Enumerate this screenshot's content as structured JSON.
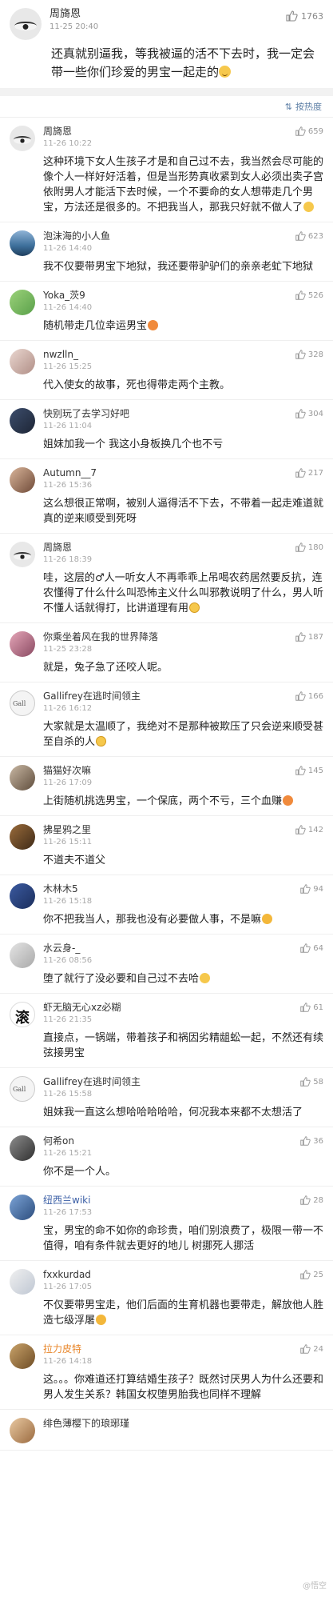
{
  "top_post": {
    "username": "周旖恩",
    "time": "11-25 20:40",
    "likes": "1763",
    "text": "还真就别逼我，等我被逼的活不下去时，我一定会带一些你们珍爱的男宝一起走的"
  },
  "sort": {
    "label": "按热度",
    "icon": "sort-icon"
  },
  "comments": [
    {
      "username": "周旖恩",
      "time": "11-26 10:22",
      "likes": "659",
      "text": "这种环境下女人生孩子才是和自己过不去，我当然会尽可能的像个人一样好好活着，但是当形势真收紧到女人必须出卖子宫依附男人才能活下去时候，一个不要命的女人想带走几个男宝，方法还是很多的。不把我当人，那我只好就不做人了"
    },
    {
      "username": "泡沫海的小人鱼",
      "time": "11-26 14:40",
      "likes": "623",
      "text": "我不仅要带男宝下地狱，我还要带驴驴们的亲亲老虻下地狱"
    },
    {
      "username": "Yoka_茨9",
      "time": "11-26 14:40",
      "likes": "526",
      "text": "随机带走几位幸运男宝"
    },
    {
      "username": "nwzlln_",
      "time": "11-26 15:25",
      "likes": "328",
      "text": "代入使女的故事，死也得带走两个主教。"
    },
    {
      "username": "快别玩了去学习好吧",
      "time": "11-26 11:04",
      "likes": "304",
      "text": "姐妹加我一个 我这小身板换几个也不亏"
    },
    {
      "username": "Autumn__7",
      "time": "11-26 15:36",
      "likes": "217",
      "text": "这么想很正常啊，被别人逼得活不下去，不带着一起走难道就真的逆来顺受到死呀"
    },
    {
      "username": "周旖恩",
      "time": "11-26 18:39",
      "likes": "180",
      "text": "哇，这层的♂人一听女人不再乖乖上吊喝农药居然要反抗，连农懂得了什么什么叫恐怖主义什么叫邪教说明了什么，男人听不懂人话就得打，比讲道理有用"
    },
    {
      "username": "你乘坐着风在我的世界降落",
      "time": "11-25 23:28",
      "likes": "187",
      "text": "就是，兔子急了还咬人呢。"
    },
    {
      "username": "Gallifrey在逃时间领主",
      "time": "11-26 16:12",
      "likes": "166",
      "text": "大家就是太温顺了，我绝对不是那种被欺压了只会逆来顺受甚至自杀的人"
    },
    {
      "username": "猫猫好次嘛",
      "time": "11-26 17:09",
      "likes": "145",
      "text": "上街随机挑选男宝，一个保底，两个不亏，三个血赚"
    },
    {
      "username": "拂星鸦之里",
      "time": "11-26 15:11",
      "likes": "142",
      "text": "不道夫不道父"
    },
    {
      "username": "木林木5",
      "time": "11-26 15:18",
      "likes": "94",
      "text": "你不把我当人，那我也没有必要做人事，不是嘛"
    },
    {
      "username": "水云身-_",
      "time": "11-26 08:56",
      "likes": "64",
      "text": "堕了就行了没必要和自己过不去哈"
    },
    {
      "username": "虾无脑无心xz必糊",
      "time": "11-26 21:35",
      "likes": "61",
      "text": "直接点，一锅端，带着孩子和祸因劣精龃蚣一起，不然还有续弦接男宝"
    },
    {
      "username": "Gallifrey在逃时间领主",
      "time": "11-26 15:58",
      "likes": "58",
      "text": "姐妹我一直这么想哈哈哈哈哈，何况我本来都不太想活了"
    },
    {
      "username": "何希on",
      "time": "11-26 15:21",
      "likes": "36",
      "text": "你不是一个人。"
    },
    {
      "username": "纽西兰wiki",
      "time": "11-26 17:53",
      "likes": "28",
      "text": "宝，男宝的命不如你的命珍贵，咱们别浪费了，极限一带一不值得，咱有条件就去更好的地儿 树挪死人挪活"
    },
    {
      "username": "fxxkurdad",
      "time": "11-26 17:05",
      "likes": "25",
      "text": "不仅要带男宝走，他们后面的生育机器也要带走，解放他人胜造七级浮屠"
    },
    {
      "username": "拉力皮特",
      "time": "11-26 14:18",
      "likes": "24",
      "text": "这。。。你难道还打算结婚生孩子？既然讨厌男人为什么还要和男人发生关系？韩国女权堕男胎我也同样不理解"
    },
    {
      "username": "绯色薄樱下的琅琊瑾",
      "time": "",
      "likes": "",
      "text": ""
    }
  ],
  "watermark": "@悟空"
}
